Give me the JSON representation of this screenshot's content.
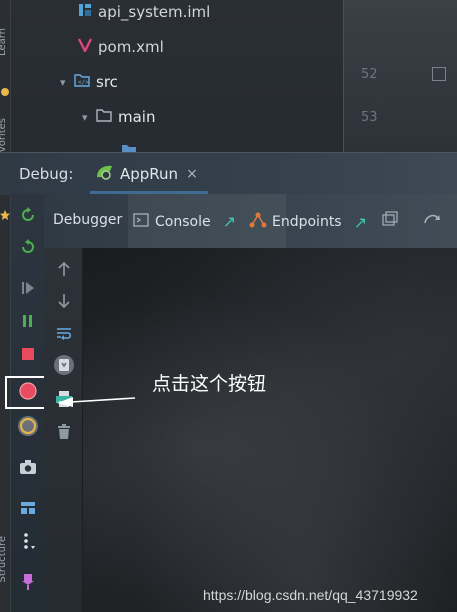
{
  "project_tree": {
    "items": [
      {
        "name": "api_system.iml",
        "icon": "module-file-icon"
      },
      {
        "name": "pom.xml",
        "icon": "maven-icon"
      },
      {
        "name": "src",
        "icon": "folder-icon"
      },
      {
        "name": "main",
        "icon": "folder-icon"
      }
    ]
  },
  "side_labels": {
    "favorites": "2: Favorites",
    "learn": "Learn",
    "structure": "Structure"
  },
  "editor": {
    "line_numbers": [
      "52",
      "53"
    ]
  },
  "debug": {
    "label": "Debug:",
    "run_config": "AppRun",
    "close": "×"
  },
  "sub_tabs": {
    "debugger": "Debugger",
    "console": "Console",
    "endpoints": "Endpoints"
  },
  "annotation": {
    "text": "点击这个按钮"
  },
  "watermark": "https://blog.csdn.net/qq_43719932",
  "colors": {
    "accent_blue": "#4a88c7",
    "run_green": "#4caf50",
    "stop_red": "#e84a5f",
    "folder_blue": "#6aa9e0",
    "iml_blue": "#4ea3d9",
    "maven_pink": "#e0457b"
  }
}
